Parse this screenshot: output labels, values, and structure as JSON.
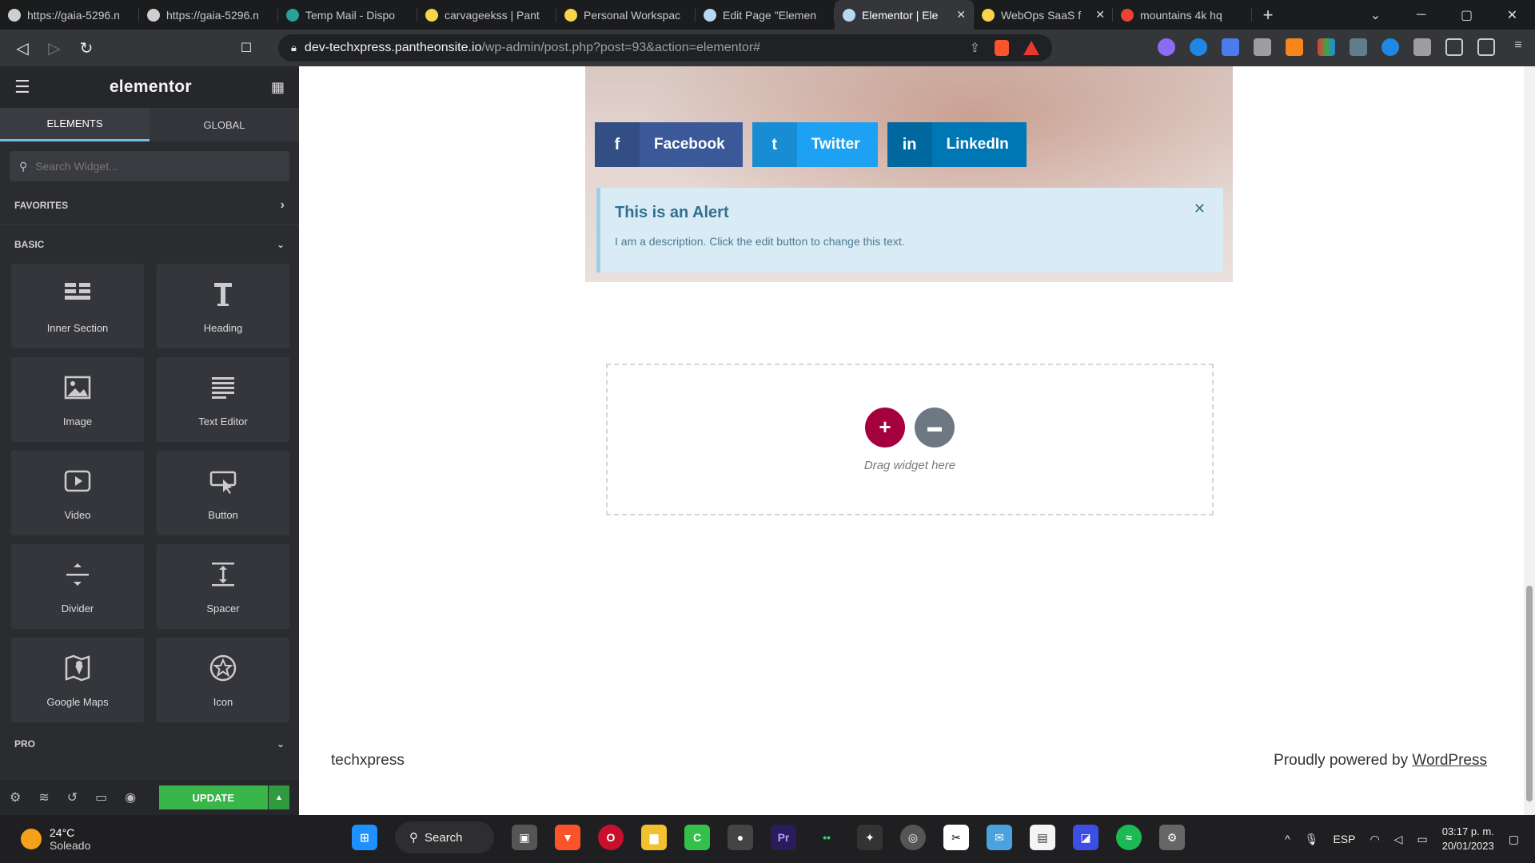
{
  "browser": {
    "tabs": [
      {
        "title": "https://gaia-5296.n",
        "color": "#cfcfcf"
      },
      {
        "title": "https://gaia-5296.n",
        "color": "#cfcfcf"
      },
      {
        "title": "Temp Mail - Dispo",
        "color": "#2aa198"
      },
      {
        "title": "carvageekss | Pant",
        "color": "#f7d44c"
      },
      {
        "title": "Personal Workspac",
        "color": "#f7d44c"
      },
      {
        "title": "Edit Page \"Elemen",
        "color": "#b8d7f0"
      },
      {
        "title": "Elementor | Ele",
        "color": "#b8d7f0",
        "active": true
      },
      {
        "title": "WebOps SaaS f",
        "color": "#f7d44c"
      },
      {
        "title": "mountains 4k hq",
        "color": "#ea4335"
      }
    ],
    "url_host": "dev-techxpress.pantheonsite.io",
    "url_path": "/wp-admin/post.php?post=93&action=elementor#"
  },
  "panel": {
    "logo": "elementor",
    "tabs": [
      "ELEMENTS",
      "GLOBAL"
    ],
    "search_placeholder": "Search Widget...",
    "favorites_label": "FAVORITES",
    "basic_label": "BASIC",
    "pro_label": "PRO",
    "widgets": [
      {
        "label": "Inner Section",
        "icon": "inner-section-icon"
      },
      {
        "label": "Heading",
        "icon": "heading-icon"
      },
      {
        "label": "Image",
        "icon": "image-icon"
      },
      {
        "label": "Text Editor",
        "icon": "text-editor-icon"
      },
      {
        "label": "Video",
        "icon": "video-icon"
      },
      {
        "label": "Button",
        "icon": "button-icon"
      },
      {
        "label": "Divider",
        "icon": "divider-icon"
      },
      {
        "label": "Spacer",
        "icon": "spacer-icon"
      },
      {
        "label": "Google Maps",
        "icon": "google-maps-icon"
      },
      {
        "label": "Icon",
        "icon": "star-icon"
      }
    ],
    "update_label": "UPDATE"
  },
  "preview": {
    "share_buttons": [
      {
        "label": "Facebook",
        "icon": "facebook-icon",
        "glyph": "f"
      },
      {
        "label": "Twitter",
        "icon": "twitter-icon",
        "glyph": "t"
      },
      {
        "label": "LinkedIn",
        "icon": "linkedin-icon",
        "glyph": "in"
      }
    ],
    "alert": {
      "title": "This is an Alert",
      "description": "I am a description. Click the edit button to change this text."
    },
    "drop_text": "Drag widget here",
    "footer": {
      "site_name": "techxpress",
      "powered_prefix": "Proudly powered by ",
      "powered_link": "WordPress"
    }
  },
  "taskbar": {
    "temperature": "24°C",
    "weather": "Soleado",
    "search_label": "Search",
    "language": "ESP",
    "time": "03:17 p. m.",
    "date": "20/01/2023"
  }
}
